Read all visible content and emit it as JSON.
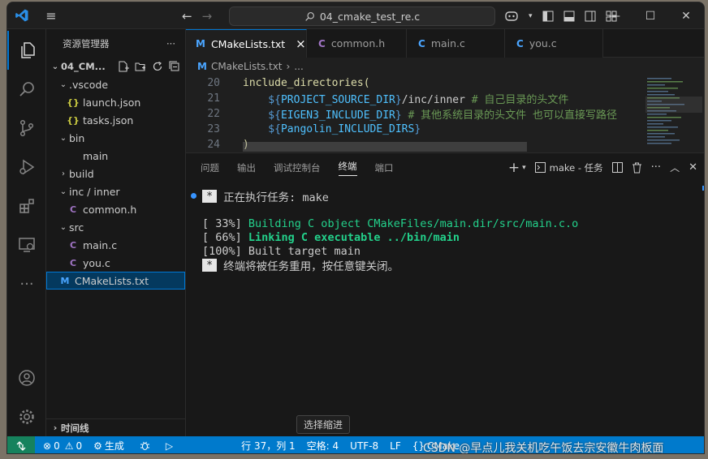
{
  "titlebar": {
    "search_text": "04_cmake_test_re.c",
    "back_arrow": "←",
    "forward_arrow": "→"
  },
  "explorer": {
    "title": "资源管理器",
    "more": "···",
    "root": "04_CM...",
    "items": [
      {
        "label": ".vscode",
        "type": "folder",
        "open": true
      },
      {
        "label": "launch.json",
        "type": "json"
      },
      {
        "label": "tasks.json",
        "type": "json"
      },
      {
        "label": "bin",
        "type": "folder",
        "open": true
      },
      {
        "label": "main",
        "type": "file"
      },
      {
        "label": "build",
        "type": "folder",
        "open": false
      },
      {
        "label": "inc / inner",
        "type": "folder",
        "open": true
      },
      {
        "label": "common.h",
        "type": "c"
      },
      {
        "label": "src",
        "type": "folder",
        "open": true
      },
      {
        "label": "main.c",
        "type": "c"
      },
      {
        "label": "you.c",
        "type": "c"
      },
      {
        "label": "CMakeLists.txt",
        "type": "cmake",
        "selected": true
      }
    ],
    "timeline": "时间线"
  },
  "tabs": [
    {
      "label": "CMakeLists.txt",
      "icon": "M",
      "active": true,
      "close": "×"
    },
    {
      "label": "common.h",
      "icon": "C"
    },
    {
      "label": "main.c",
      "icon": "C"
    },
    {
      "label": "you.c",
      "icon": "C"
    }
  ],
  "breadcrumb": {
    "file": "CMakeLists.txt",
    "sep": "›",
    "more": "..."
  },
  "code": {
    "lines": [
      {
        "n": "20",
        "parts": [
          {
            "t": "include_directories(",
            "c": "#dcdcaa"
          }
        ]
      },
      {
        "n": "21",
        "parts": [
          {
            "t": "    ${",
            "c": "#569cd6"
          },
          {
            "t": "PROJECT_SOURCE_DIR",
            "c": "#4fc1ff"
          },
          {
            "t": "}",
            "c": "#569cd6"
          },
          {
            "t": "/inc/inner ",
            "c": "#cccccc"
          },
          {
            "t": "# 自己目录的头文件",
            "c": "#6a9955"
          }
        ]
      },
      {
        "n": "22",
        "parts": [
          {
            "t": "    ${",
            "c": "#569cd6"
          },
          {
            "t": "EIGEN3_INCLUDE_DIR",
            "c": "#4fc1ff"
          },
          {
            "t": "} ",
            "c": "#569cd6"
          },
          {
            "t": "# 其他系统目录的头文件 也可以直接写路径",
            "c": "#6a9955"
          }
        ]
      },
      {
        "n": "23",
        "parts": [
          {
            "t": "    ${",
            "c": "#569cd6"
          },
          {
            "t": "Pangolin_INCLUDE_DIRS",
            "c": "#4fc1ff"
          },
          {
            "t": "}",
            "c": "#569cd6"
          }
        ]
      },
      {
        "n": "24",
        "parts": [
          {
            "t": ")",
            "c": "#dcdcaa"
          }
        ]
      }
    ]
  },
  "panel": {
    "tabs": [
      "问题",
      "输出",
      "调试控制台",
      "终端",
      "端口"
    ],
    "active_tab": "终端",
    "task_label": "make - 任务",
    "terminal": {
      "line1_star": "*",
      "line1": "正在执行任务: make",
      "line2_prefix": "[ 33%] ",
      "line2": "Building C object CMakeFiles/main.dir/src/main.c.o",
      "line3_prefix": "[ 66%] ",
      "line3": "Linking C executable ../bin/main",
      "line4": "[100%] Built target main",
      "line5_star": "*",
      "line5": "终端将被任务重用，按任意键关闭。"
    },
    "tooltip": "选择缩进"
  },
  "statusbar": {
    "errors": "0",
    "warnings": "0",
    "build": "生成",
    "position": "行 37，列 1",
    "spaces": "空格: 4",
    "encoding": "UTF-8",
    "eol": "LF",
    "language": "CMake"
  },
  "watermark": "CSDN @早点儿我关机吃午饭去宗安徽牛肉板面",
  "colors": {
    "accent": "#0078d4",
    "statusbar": "#007acc",
    "cmake_icon": "#4aa5ff",
    "c_icon": "#a074c4",
    "json_icon": "#cbcb41"
  }
}
